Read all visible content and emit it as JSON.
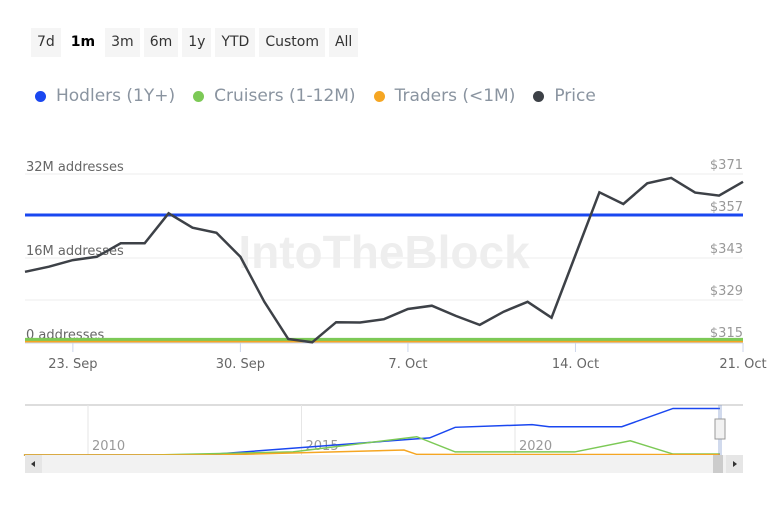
{
  "range_buttons": [
    {
      "label": "7d"
    },
    {
      "label": "1m",
      "active": true
    },
    {
      "label": "3m"
    },
    {
      "label": "6m"
    },
    {
      "label": "1y"
    },
    {
      "label": "YTD"
    },
    {
      "label": "Custom"
    },
    {
      "label": "All"
    }
  ],
  "watermark": "IntoTheBlock",
  "chart_data": {
    "type": "line",
    "legend_position": "top-left",
    "series": [
      {
        "name": "Hodlers (1Y+)",
        "color": "#1a47f0",
        "axis": "left",
        "unit": "M addresses",
        "values_constant": 24.2
      },
      {
        "name": "Cruisers (1-12M)",
        "color": "#7cc956",
        "axis": "left",
        "unit": "M addresses",
        "values_constant": 0.5
      },
      {
        "name": "Traders (<1M)",
        "color": "#f5a623",
        "axis": "left",
        "unit": "M addresses",
        "values_constant": 0.2
      },
      {
        "name": "Price",
        "color": "#3d4147",
        "axis": "right",
        "unit": "USD",
        "dates": [
          "2023-09-21",
          "2023-09-22",
          "2023-09-23",
          "2023-09-24",
          "2023-09-25",
          "2023-09-26",
          "2023-09-27",
          "2023-09-28",
          "2023-09-29",
          "2023-09-30",
          "2023-10-01",
          "2023-10-02",
          "2023-10-03",
          "2023-10-04",
          "2023-10-05",
          "2023-10-06",
          "2023-10-07",
          "2023-10-08",
          "2023-10-09",
          "2023-10-10",
          "2023-10-11",
          "2023-10-12",
          "2023-10-13",
          "2023-10-14",
          "2023-10-15",
          "2023-10-16",
          "2023-10-17",
          "2023-10-18",
          "2023-10-19",
          "2023-10-20",
          "2023-10-21"
        ],
        "values": [
          338.4,
          340.1,
          342.3,
          343.4,
          347.9,
          347.9,
          357.9,
          353.1,
          351.4,
          343.4,
          328.4,
          316.0,
          314.9,
          321.6,
          321.5,
          322.6,
          326.0,
          327.1,
          323.7,
          320.7,
          325.1,
          328.4,
          323.1,
          344.0,
          364.9,
          361.0,
          367.9,
          369.7,
          364.8,
          363.8,
          368.4
        ]
      }
    ],
    "x_ticks": [
      "23. Sep",
      "30. Sep",
      "7. Oct",
      "14. Oct",
      "21. Oct"
    ],
    "x_tick_dates": [
      "2023-09-23",
      "2023-09-30",
      "2023-10-07",
      "2023-10-14",
      "2023-10-21"
    ],
    "y_left": {
      "ticks": [
        "0 addresses",
        "16M addresses",
        "32M addresses"
      ],
      "values": [
        0,
        16,
        32
      ],
      "range": [
        0,
        32
      ]
    },
    "y_right": {
      "ticks": [
        "$315",
        "$329",
        "$343",
        "$357",
        "$371"
      ],
      "values": [
        315,
        329,
        343,
        357,
        371
      ],
      "range": [
        315,
        371
      ]
    },
    "grid": true,
    "navigator": {
      "x_ticks": [
        "2010",
        "2015",
        "2020"
      ],
      "series": [
        {
          "name": "Hodlers (1Y+)",
          "color": "#1a47f0",
          "points": [
            [
              2008.5,
              0
            ],
            [
              2012.7,
              0
            ],
            [
              2018.0,
              8.9
            ],
            [
              2018.6,
              14.4
            ],
            [
              2020.4,
              15.8
            ],
            [
              2020.8,
              14.7
            ],
            [
              2022.5,
              14.7
            ],
            [
              2023.7,
              24.2
            ],
            [
              2024.8,
              24.2
            ]
          ]
        },
        {
          "name": "Cruisers (1-12M)",
          "color": "#7cc956",
          "points": [
            [
              2008.5,
              0
            ],
            [
              2011.5,
              0
            ],
            [
              2014.8,
              1.6
            ],
            [
              2017.7,
              9.5
            ],
            [
              2018.6,
              1.6
            ],
            [
              2021.4,
              1.6
            ],
            [
              2022.7,
              7.4
            ],
            [
              2023.7,
              0.5
            ],
            [
              2024.8,
              0.5
            ]
          ]
        },
        {
          "name": "Traders (<1M)",
          "color": "#f5a623",
          "points": [
            [
              2008.5,
              0
            ],
            [
              2013,
              0
            ],
            [
              2017.4,
              2.6
            ],
            [
              2017.7,
              0.3
            ],
            [
              2024.8,
              0.2
            ]
          ]
        }
      ]
    }
  }
}
